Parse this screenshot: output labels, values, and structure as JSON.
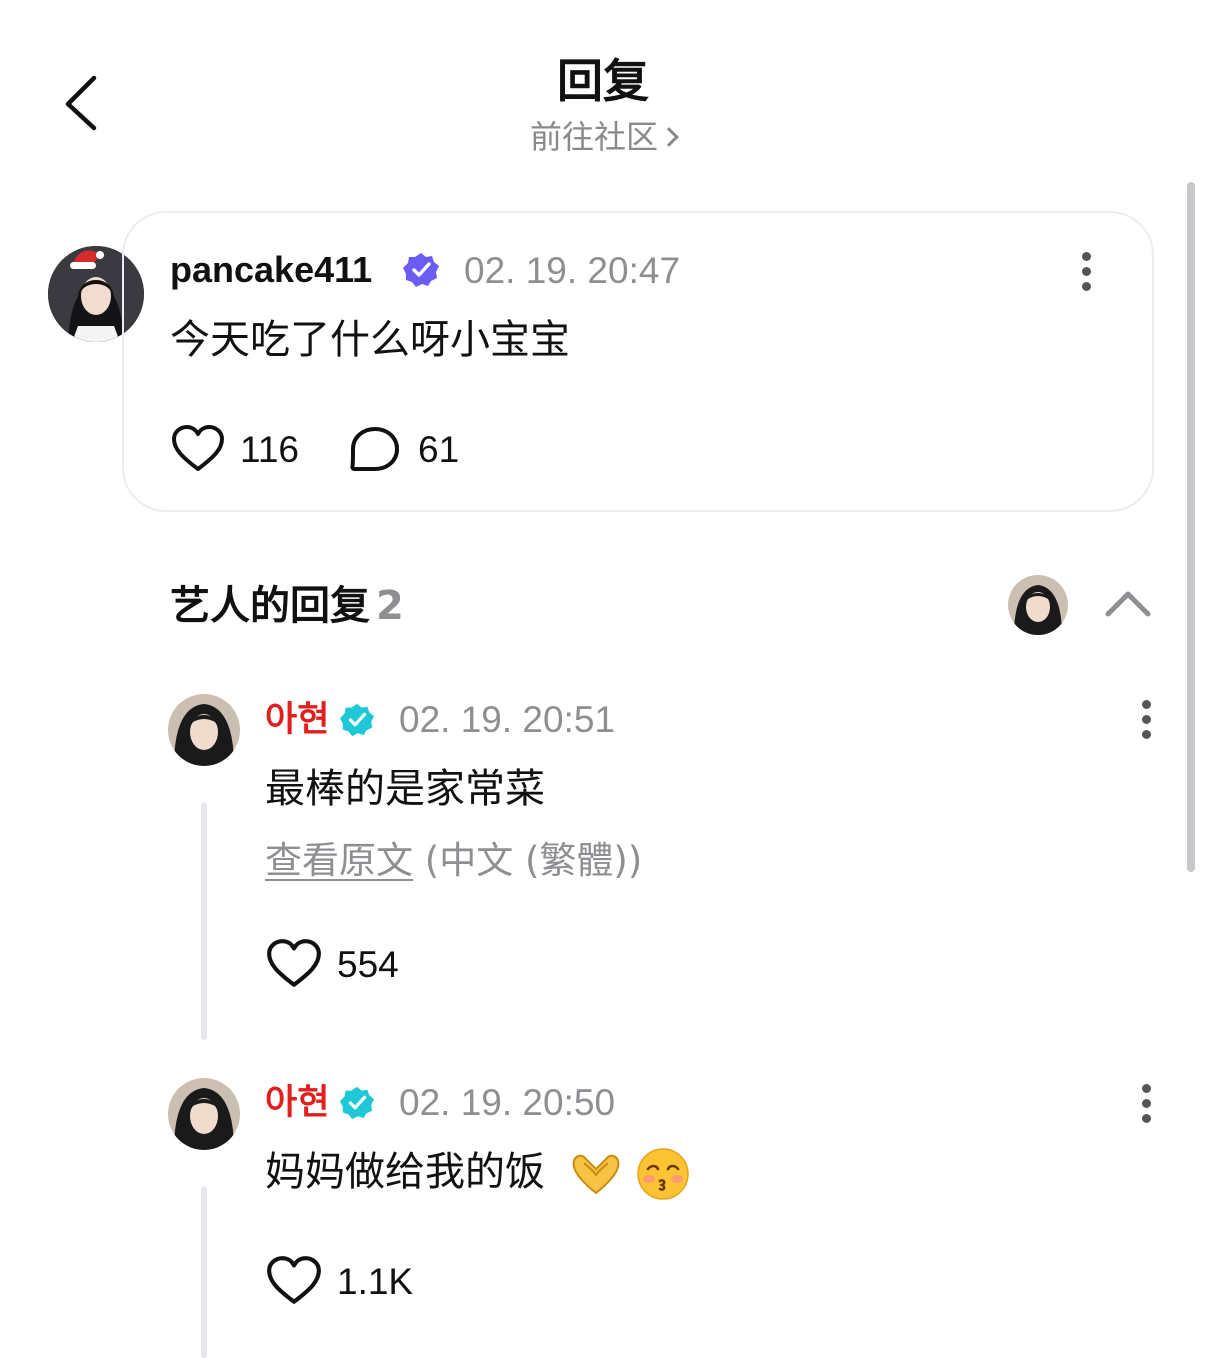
{
  "header": {
    "title": "回复",
    "subtitle": "前往社区"
  },
  "post": {
    "username": "pancake411",
    "timestamp": "02. 19. 20:47",
    "text": "今天吃了什么呀小宝宝",
    "likes": "116",
    "comments": "61",
    "icons": [
      "santa-hat-icon",
      "verified-badge-icon",
      "more-icon",
      "heart-icon",
      "comment-bubble-icon"
    ]
  },
  "artist_replies": {
    "title": "艺人的回复",
    "count": "2",
    "replies": [
      {
        "name": "아현",
        "timestamp": "02. 19. 20:51",
        "text": "最棒的是家常菜",
        "translate_link": "查看原文",
        "translate_lang": "(中文 (繁體))",
        "likes": "554"
      },
      {
        "name": "아현",
        "timestamp": "02. 19. 20:50",
        "text": "妈妈做给我的饭",
        "emojis": [
          "heart-hands-emoji",
          "kissing-face-emoji"
        ],
        "likes": "1.1K"
      }
    ]
  },
  "colors": {
    "artist_name": "#e0201e",
    "verified_artist": "#1ec8d6",
    "verified_fan": "#6b5cf5",
    "muted_text": "#8e8e93",
    "card_border": "#ececf2"
  }
}
